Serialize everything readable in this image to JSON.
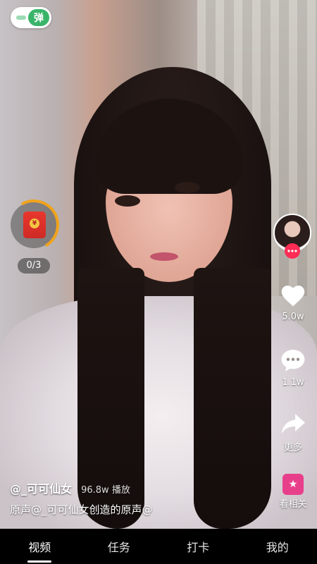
{
  "top": {
    "danmu_label": "弹"
  },
  "reward": {
    "currency_symbol": "¥",
    "progress_text": "0/3",
    "progress_fraction": 0.3
  },
  "actions": {
    "like_count": "5.0w",
    "comment_count": "1.1w",
    "share_label": "更多",
    "related_label": "看相关"
  },
  "caption": {
    "author": "@_可可仙女",
    "views": "96.8w 播放",
    "music": "原声@_可可仙女创造的原声@"
  },
  "nav": {
    "items": [
      {
        "label": "视频",
        "active": true
      },
      {
        "label": "任务",
        "active": false
      },
      {
        "label": "打卡",
        "active": false
      },
      {
        "label": "我的",
        "active": false
      }
    ]
  },
  "colors": {
    "accent": "#fe2c55",
    "toggle": "#39b56a",
    "related": "#e83f8b",
    "reward_ring": "#f0a31a"
  },
  "icons": [
    "heart-icon",
    "comment-icon",
    "share-arrow-icon",
    "star-icon",
    "plus-icon"
  ]
}
